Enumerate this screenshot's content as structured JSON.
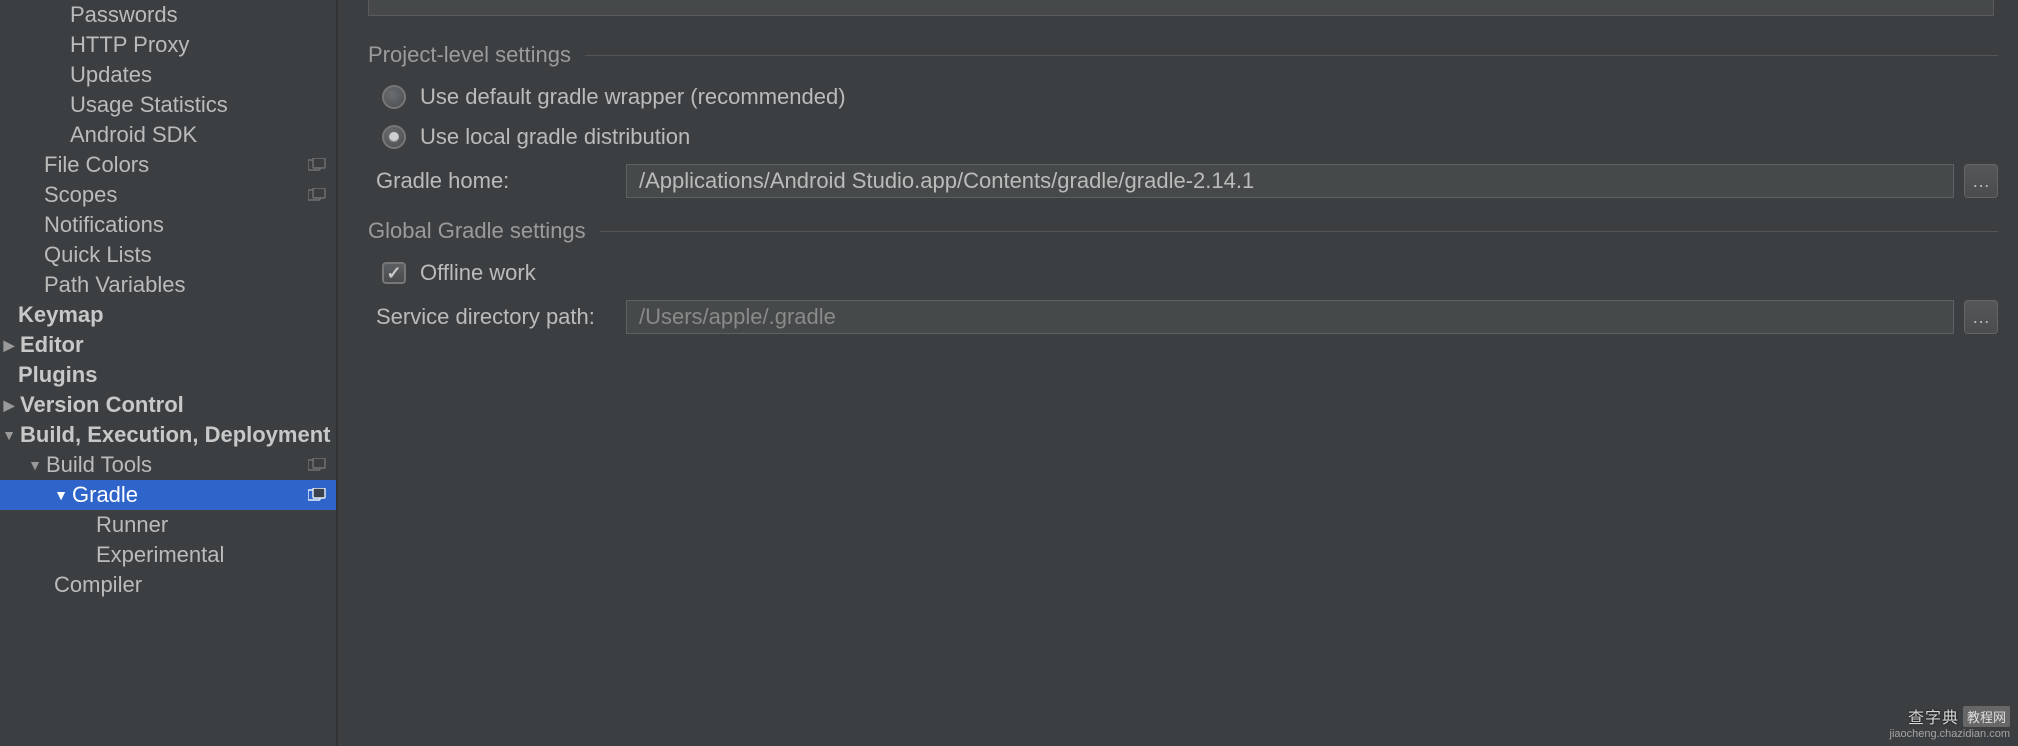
{
  "sidebar": {
    "items": [
      {
        "label": "Passwords",
        "indent": 70,
        "arrow": "",
        "bold": false,
        "badge": false,
        "selected": false
      },
      {
        "label": "HTTP Proxy",
        "indent": 70,
        "arrow": "",
        "bold": false,
        "badge": false,
        "selected": false
      },
      {
        "label": "Updates",
        "indent": 70,
        "arrow": "",
        "bold": false,
        "badge": false,
        "selected": false
      },
      {
        "label": "Usage Statistics",
        "indent": 70,
        "arrow": "",
        "bold": false,
        "badge": false,
        "selected": false
      },
      {
        "label": "Android SDK",
        "indent": 70,
        "arrow": "",
        "bold": false,
        "badge": false,
        "selected": false
      },
      {
        "label": "File Colors",
        "indent": 44,
        "arrow": "",
        "bold": false,
        "badge": true,
        "selected": false
      },
      {
        "label": "Scopes",
        "indent": 44,
        "arrow": "",
        "bold": false,
        "badge": true,
        "selected": false
      },
      {
        "label": "Notifications",
        "indent": 44,
        "arrow": "",
        "bold": false,
        "badge": false,
        "selected": false
      },
      {
        "label": "Quick Lists",
        "indent": 44,
        "arrow": "",
        "bold": false,
        "badge": false,
        "selected": false
      },
      {
        "label": "Path Variables",
        "indent": 44,
        "arrow": "",
        "bold": false,
        "badge": false,
        "selected": false
      },
      {
        "label": "Keymap",
        "indent": 18,
        "arrow": "",
        "bold": true,
        "badge": false,
        "selected": false
      },
      {
        "label": "Editor",
        "indent": 2,
        "arrow": "▶",
        "bold": true,
        "badge": false,
        "selected": false
      },
      {
        "label": "Plugins",
        "indent": 18,
        "arrow": "",
        "bold": true,
        "badge": false,
        "selected": false
      },
      {
        "label": "Version Control",
        "indent": 2,
        "arrow": "▶",
        "bold": true,
        "badge": false,
        "selected": false
      },
      {
        "label": "Build, Execution, Deployment",
        "indent": 2,
        "arrow": "▼",
        "bold": true,
        "badge": false,
        "selected": false
      },
      {
        "label": "Build Tools",
        "indent": 28,
        "arrow": "▼",
        "bold": false,
        "badge": true,
        "selected": false
      },
      {
        "label": "Gradle",
        "indent": 54,
        "arrow": "▼",
        "bold": false,
        "badge": true,
        "selected": true
      },
      {
        "label": "Runner",
        "indent": 96,
        "arrow": "",
        "bold": false,
        "badge": false,
        "selected": false
      },
      {
        "label": "Experimental",
        "indent": 96,
        "arrow": "",
        "bold": false,
        "badge": false,
        "selected": false
      },
      {
        "label": "Compiler",
        "indent": 54,
        "arrow": "",
        "bold": false,
        "badge": false,
        "selected": false
      }
    ]
  },
  "sections": {
    "project": "Project-level settings",
    "global": "Global Gradle settings"
  },
  "radios": {
    "wrapper": "Use default gradle wrapper (recommended)",
    "local": "Use local gradle distribution"
  },
  "fields": {
    "gradle_home_label": "Gradle home:",
    "gradle_home_value": "/Applications/Android Studio.app/Contents/gradle/gradle-2.14.1",
    "offline_label": "Offline work",
    "service_dir_label": "Service directory path:",
    "service_dir_value": "/Users/apple/.gradle",
    "browse": "…"
  },
  "watermark": {
    "text": "查字典",
    "tag": "教程网",
    "sub": "jiaocheng.chazidian.com"
  }
}
